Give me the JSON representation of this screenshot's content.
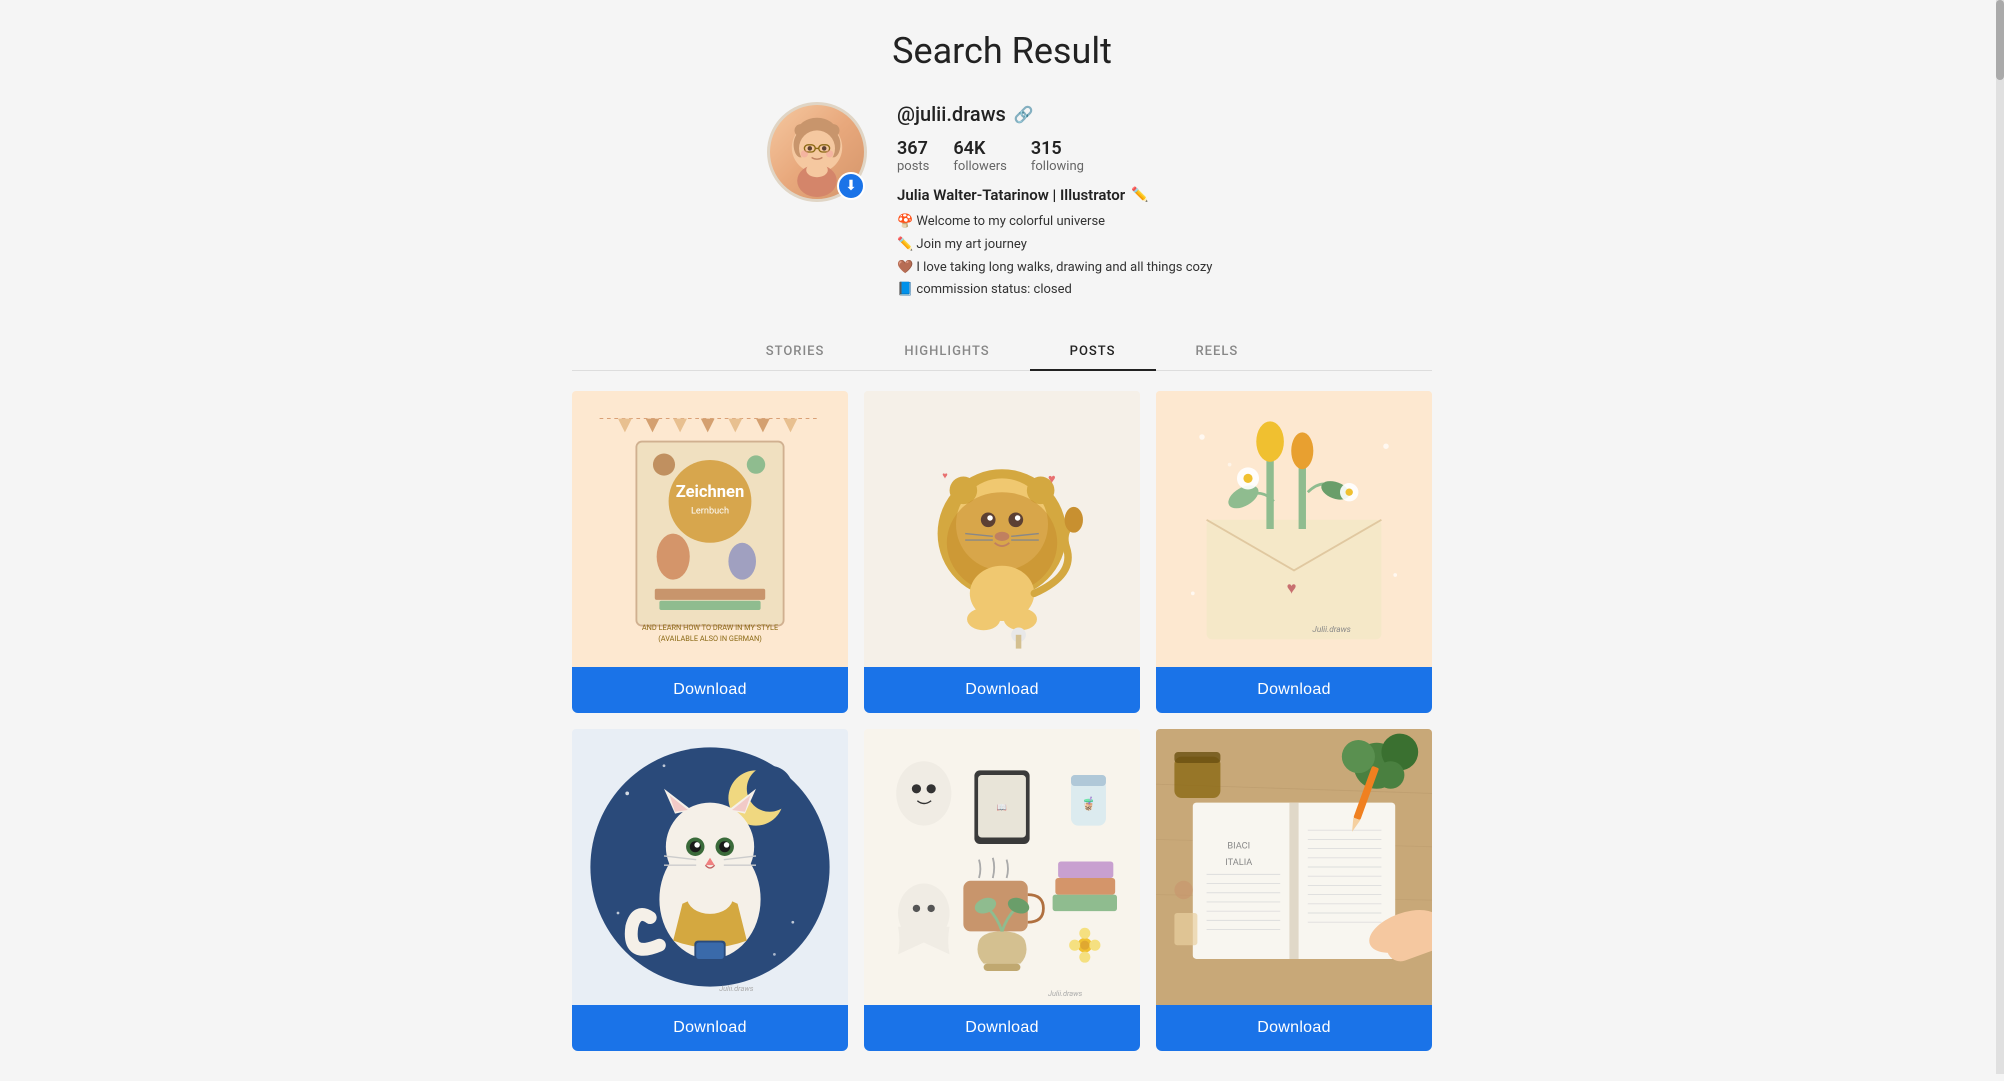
{
  "page": {
    "title": "Search Result"
  },
  "profile": {
    "username": "@julii.draws",
    "stats": {
      "posts": {
        "number": "367",
        "label": "posts"
      },
      "followers": {
        "number": "64K",
        "label": "followers"
      },
      "following": {
        "number": "315",
        "label": "following"
      }
    },
    "full_name": "Julia Walter-Tatarinow | Illustrator",
    "bio_lines": [
      "🍄 Welcome to my colorful universe",
      "✏️ Join my art journey",
      "🤎 I love taking long walks, drawing and all things cozy",
      "📘 commission status: closed"
    ]
  },
  "tabs": [
    {
      "id": "stories",
      "label": "STORIES",
      "active": false
    },
    {
      "id": "highlights",
      "label": "HIGHLIGHTS",
      "active": false
    },
    {
      "id": "posts",
      "label": "POSTS",
      "active": true
    },
    {
      "id": "reels",
      "label": "REELS",
      "active": false
    }
  ],
  "posts": [
    {
      "id": 1,
      "type": "book-illustration",
      "download_label": "Download",
      "bg": "#fde8d0"
    },
    {
      "id": 2,
      "type": "lion",
      "download_label": "Download",
      "bg": "#f5f0e8"
    },
    {
      "id": 3,
      "type": "envelope-flowers",
      "download_label": "Download",
      "bg": "#fde8d0"
    },
    {
      "id": 4,
      "type": "cat-moon",
      "download_label": "Download",
      "bg": "#d8e4f0"
    },
    {
      "id": 5,
      "type": "cozy-items",
      "download_label": "Download",
      "bg": "#f8f4ec"
    },
    {
      "id": 6,
      "type": "notebook",
      "download_label": "Download",
      "bg": "#c8b898"
    }
  ],
  "colors": {
    "download_button": "#1a73e8",
    "active_tab_border": "#222222"
  }
}
